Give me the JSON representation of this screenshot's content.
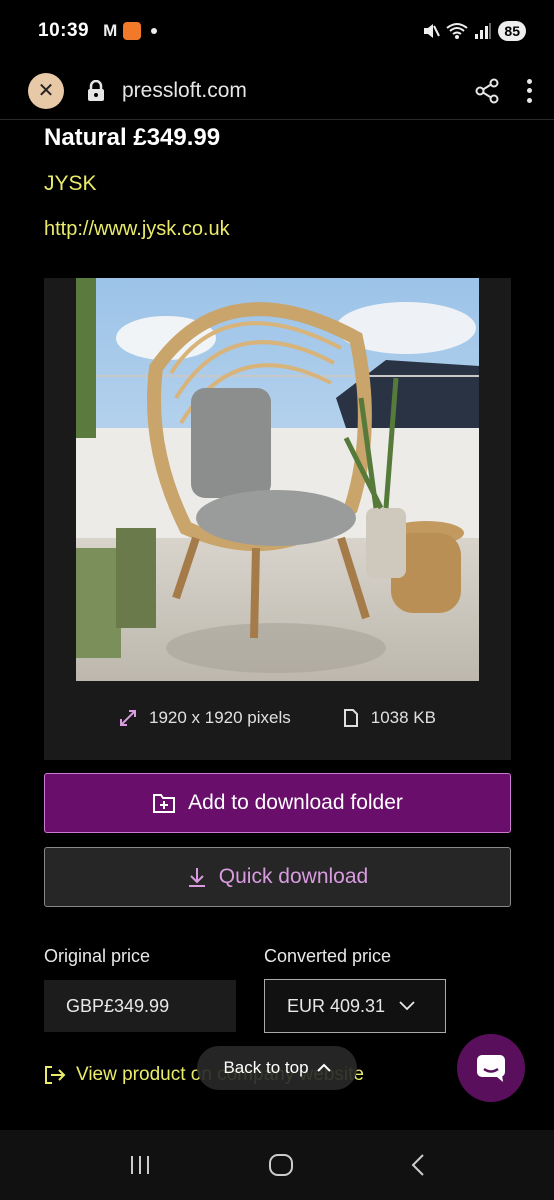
{
  "status_bar": {
    "time": "10:39",
    "battery": "85",
    "icons": [
      "gmail-icon",
      "app-notification-icon",
      "dot-icon",
      "mute-icon",
      "wifi-icon",
      "signal-icon"
    ]
  },
  "browser": {
    "url": "pressloft.com",
    "icons": [
      "close-icon",
      "lock-icon",
      "share-icon",
      "more-vert-icon"
    ]
  },
  "product": {
    "title": "Natural £349.99",
    "brand": "JYSK",
    "website": "http://www.jysk.co.uk",
    "image": {
      "dimensions": "1920 x 1920 pixels",
      "size": "1038 KB",
      "description_icon_names": [
        "resize-icon",
        "file-icon"
      ]
    }
  },
  "actions": {
    "add_to_folder": "Add to download folder",
    "quick_download": "Quick download"
  },
  "prices": {
    "original_label": "Original price",
    "original_value": "GBP£349.99",
    "converted_label": "Converted price",
    "converted_value": "EUR 409.31"
  },
  "footer": {
    "view_product": "View product on company website",
    "back_to_top": "Back to top"
  },
  "colors": {
    "accent_yellow": "#eaeb6a",
    "primary_purple": "#6a0e6b",
    "link_purple": "#d99be0",
    "close_bg": "#e8c9a7"
  }
}
